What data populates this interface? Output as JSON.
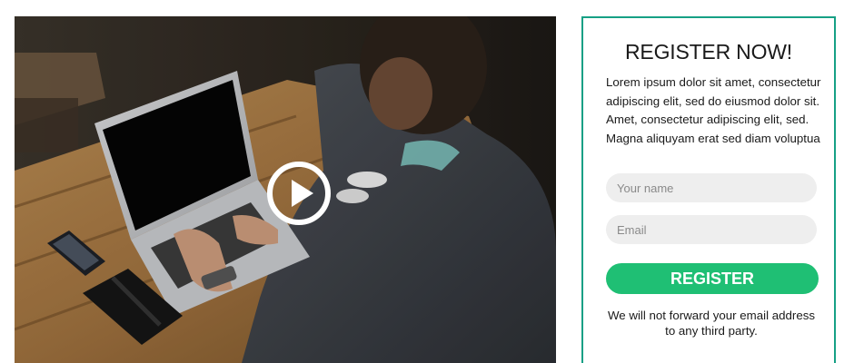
{
  "video": {
    "play_icon": "play-circle-icon"
  },
  "form": {
    "title": "REGISTER NOW!",
    "description": "Lorem ipsum dolor sit amet, consectetur adipiscing elit, sed do eiusmod dolor sit. Amet, consectetur adipiscing elit, sed. Magna aliquyam erat sed diam voluptua",
    "name_placeholder": "Your name",
    "email_placeholder": "Email",
    "submit_label": "REGISTER",
    "privacy_note": "We will not forward your email address to any third party."
  },
  "colors": {
    "accent_border": "#16a085",
    "button": "#1fbf74",
    "input_bg": "#eeeeee"
  }
}
